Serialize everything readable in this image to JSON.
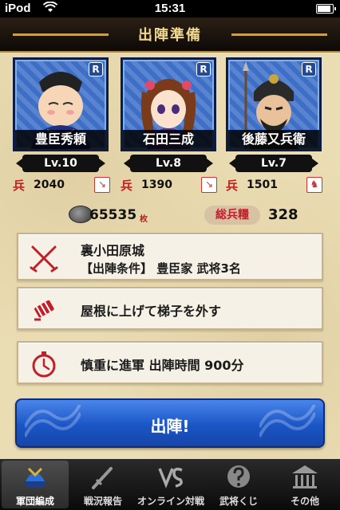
{
  "status_bar": {
    "carrier": "iPod",
    "time": "15:31"
  },
  "header": {
    "title": "出陣準備"
  },
  "generals": [
    {
      "name": "豊臣秀頼",
      "level": "Lv.10",
      "troops_label": "兵",
      "troops": "2040",
      "rarity": "R"
    },
    {
      "name": "石田三成",
      "level": "Lv.8",
      "troops_label": "兵",
      "troops": "1390",
      "rarity": "R"
    },
    {
      "name": "後藤又兵衛",
      "level": "Lv.7",
      "troops_label": "兵",
      "troops": "1501",
      "rarity": "R"
    }
  ],
  "resources": {
    "coins": "65535",
    "coins_unit": "枚",
    "supply_label": "総兵糧",
    "supply": "328"
  },
  "mission": {
    "castle": "裏小田原城",
    "condition": "【出陣条件】 豊臣家 武将3名",
    "strategy": "屋根に上げて梯子を外す",
    "march": "慎重に進軍 出陣時間 900分"
  },
  "deploy_button": {
    "label": "出陣!"
  },
  "tabs": [
    {
      "label": "軍団編成",
      "icon": "helmet-icon",
      "active": true
    },
    {
      "label": "戦況報告",
      "icon": "sword-icon",
      "active": false
    },
    {
      "label": "オンライン対戦",
      "icon": "versus-icon",
      "active": false
    },
    {
      "label": "武将くじ",
      "icon": "lottery-icon",
      "active": false
    },
    {
      "label": "その他",
      "icon": "temple-icon",
      "active": false
    }
  ],
  "colors": {
    "accent_blue": "#1a55c6",
    "paper": "#eadcb3",
    "title_gold": "#f3d88f",
    "red": "#c0202a"
  }
}
